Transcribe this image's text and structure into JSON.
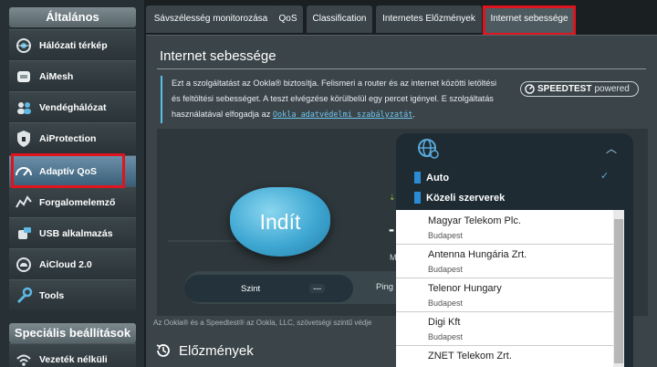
{
  "sidebar": {
    "general_header": "Általános",
    "special_header": "Speciális beállítások",
    "items": [
      {
        "label": "Hálózati térkép",
        "icon": "network-map-icon"
      },
      {
        "label": "AiMesh",
        "icon": "aimesh-icon"
      },
      {
        "label": "Vendéghálózat",
        "icon": "guest-network-icon"
      },
      {
        "label": "AiProtection",
        "icon": "shield-icon"
      },
      {
        "label": "Adaptív QoS",
        "icon": "gauge-icon"
      },
      {
        "label": "Forgalomelemző",
        "icon": "traffic-analyzer-icon"
      },
      {
        "label": "USB alkalmazás",
        "icon": "usb-icon"
      },
      {
        "label": "AiCloud 2.0",
        "icon": "cloud-icon"
      },
      {
        "label": "Tools",
        "icon": "wrench-icon"
      },
      {
        "label": "Vezeték nélküli",
        "icon": "wireless-icon"
      }
    ]
  },
  "tabs": [
    {
      "label": "Sávszélesség monitorozása"
    },
    {
      "label": "QoS"
    },
    {
      "label": "Classification"
    },
    {
      "label": "Internetes Előzmények"
    },
    {
      "label": "Internet sebessége"
    }
  ],
  "panel": {
    "title": "Internet sebessége",
    "description": "Ezt a szolgáltatást az Ookla® biztosítja. Felismeri a router és az internet közötti letöltési és feltöltési sebességet. A teszt elvégzése körülbelül egy percet igényel. E szolgáltatás használatával elfogadja az",
    "privacy_link": "Ookla adatvédelmi szabályzatát",
    "privacy_suffix": ".",
    "speedtest_logo_brand": "SPEEDTEST",
    "speedtest_logo_suffix": "powered",
    "start_button": "Indít",
    "level_label": "Szint",
    "level_value": "---",
    "ping_label": "Ping",
    "dash_value": "-",
    "unit_label": "M",
    "footer_note": "Az Ookla® és a Speedtest® az Ookla, LLC, szövetségi szintű védje",
    "history_title": "Előzmények"
  },
  "dropdown": {
    "auto_label": "Auto",
    "nearby_label": "Közeli szerverek",
    "servers": [
      {
        "name": "Magyar Telekom Plc.",
        "city": "Budapest"
      },
      {
        "name": "Antenna Hungária Zrt.",
        "city": "Budapest"
      },
      {
        "name": "Telenor Hungary",
        "city": "Budapest"
      },
      {
        "name": "Digi Kft",
        "city": "Budapest"
      },
      {
        "name": "ZNET Telekom Zrt.",
        "city": ""
      }
    ]
  },
  "colors": {
    "highlight": "#e0141e",
    "accent": "#59c1e8",
    "start_button": "#3ea7d2"
  }
}
